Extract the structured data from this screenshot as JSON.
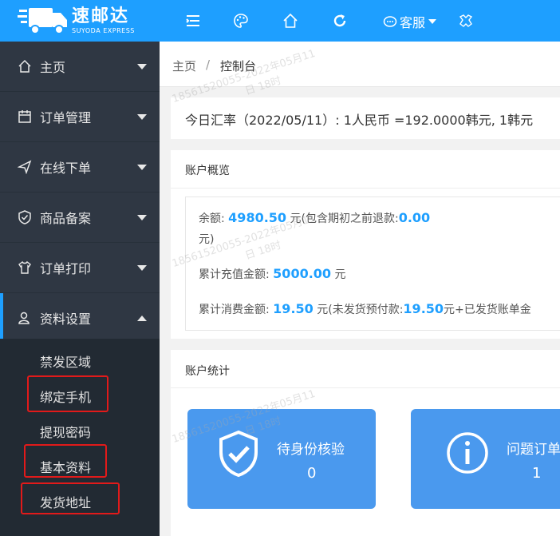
{
  "brand": {
    "name_cn": "速邮达",
    "name_en": "SUYODA EXPRESS"
  },
  "topbar": {
    "service_label": "客服"
  },
  "sidebar": {
    "items": [
      {
        "label": "主页"
      },
      {
        "label": "订单管理"
      },
      {
        "label": "在线下单"
      },
      {
        "label": "商品备案"
      },
      {
        "label": "订单打印"
      },
      {
        "label": "资料设置"
      }
    ],
    "subitems": [
      {
        "label": "禁发区域"
      },
      {
        "label": "绑定手机"
      },
      {
        "label": "提现密码"
      },
      {
        "label": "基本资料"
      },
      {
        "label": "发货地址"
      }
    ]
  },
  "breadcrumb": {
    "home": "主页",
    "sep": "/",
    "current": "控制台"
  },
  "rate": {
    "text": "今日汇率（2022/05/11）: 1人民币 =192.0000韩元, 1韩元"
  },
  "account": {
    "title": "账户概览",
    "balance_label": "余额:",
    "balance_value": "4980.50",
    "balance_unit_pre": "元(包含期初之前退款:",
    "refund_value": "0.00",
    "balance_unit_post": "元)",
    "recharge_label": "累计充值金额:",
    "recharge_value": "5000.00",
    "recharge_unit": "元",
    "consume_label": "累计消费金额:",
    "consume_value": "19.50",
    "consume_mid": "元(未发货预付款:",
    "prepaid_value": "19.50",
    "consume_tail": "元+已发货账单金"
  },
  "stats": {
    "title": "账户统计",
    "tiles": [
      {
        "label": "待身份核验",
        "count": "0"
      },
      {
        "label": "问题订单",
        "count": "1"
      }
    ]
  },
  "watermark": {
    "line1": "18561520055-2022年05月11",
    "line2": "日 18时"
  },
  "colors": {
    "accent": "#1e9fff",
    "sidebar": "#2f3743",
    "highlight": "#e21a1a",
    "tile": "#4a99ee"
  }
}
